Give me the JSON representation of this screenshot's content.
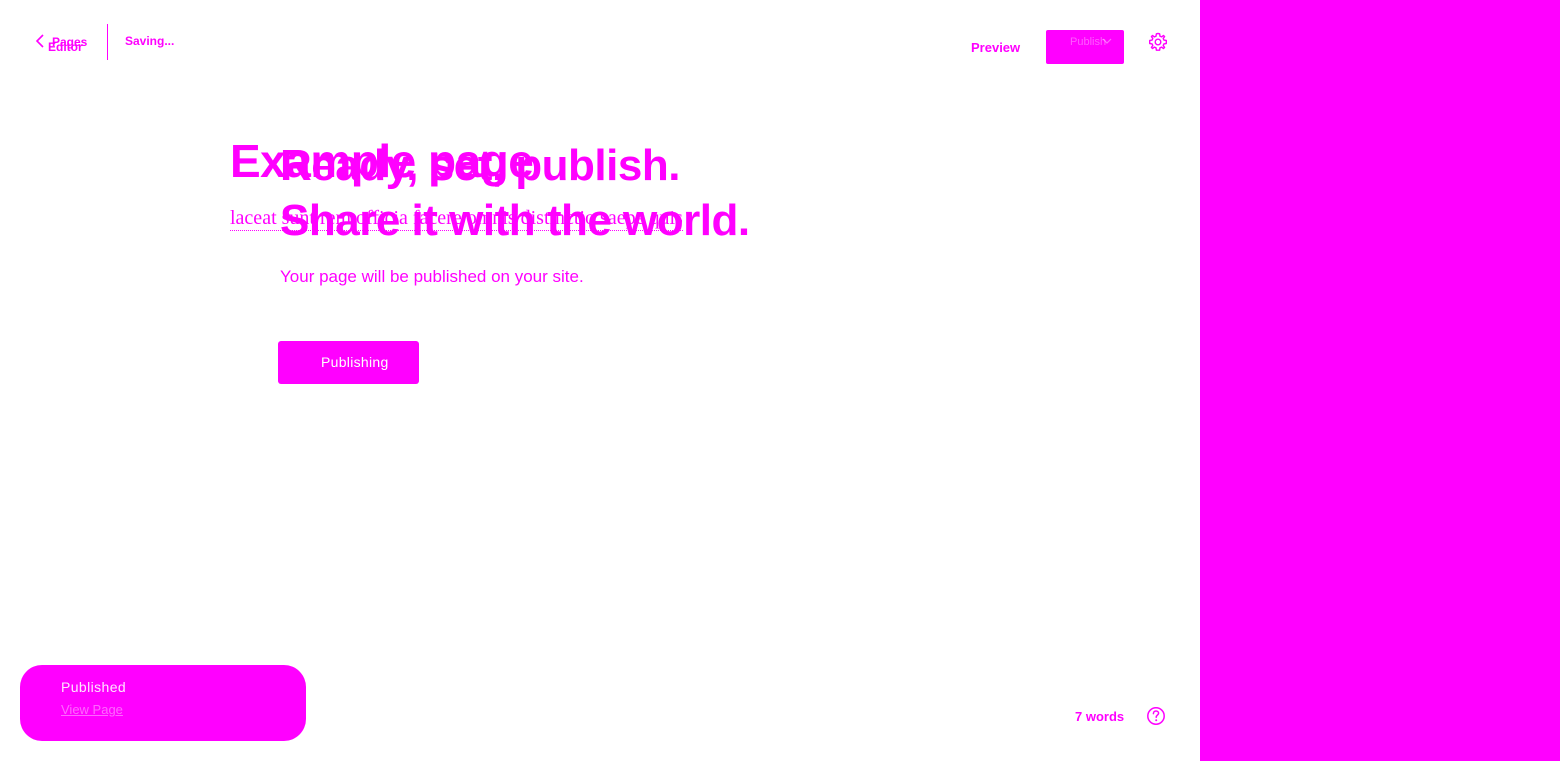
{
  "topbar": {
    "back_label": "Pages",
    "back_label_overlap": "Editor",
    "status": "Saving...",
    "preview_label": "Preview",
    "publish_label": "Publish",
    "icons": {
      "back": "chevron-left-icon",
      "publish_menu": "chevron-down-icon",
      "settings": "gear-icon"
    }
  },
  "editor": {
    "title_ghost": "Example page",
    "body_ghost": "laceat sunt rem officia facere omnis distinctio saepe quis"
  },
  "publish_panel": {
    "heading_line1": "Ready, set, publish.",
    "heading_line2": "Share it with the world.",
    "subtitle": "Your page will be published on your site.",
    "button_label": "Publishing"
  },
  "snackbar": {
    "status": "Published",
    "link_label": "View Page"
  },
  "footer": {
    "word_count": "7 words",
    "help_icon": "help-icon"
  },
  "colors": {
    "accent": "#ff00ff",
    "background": "#ffffff"
  }
}
